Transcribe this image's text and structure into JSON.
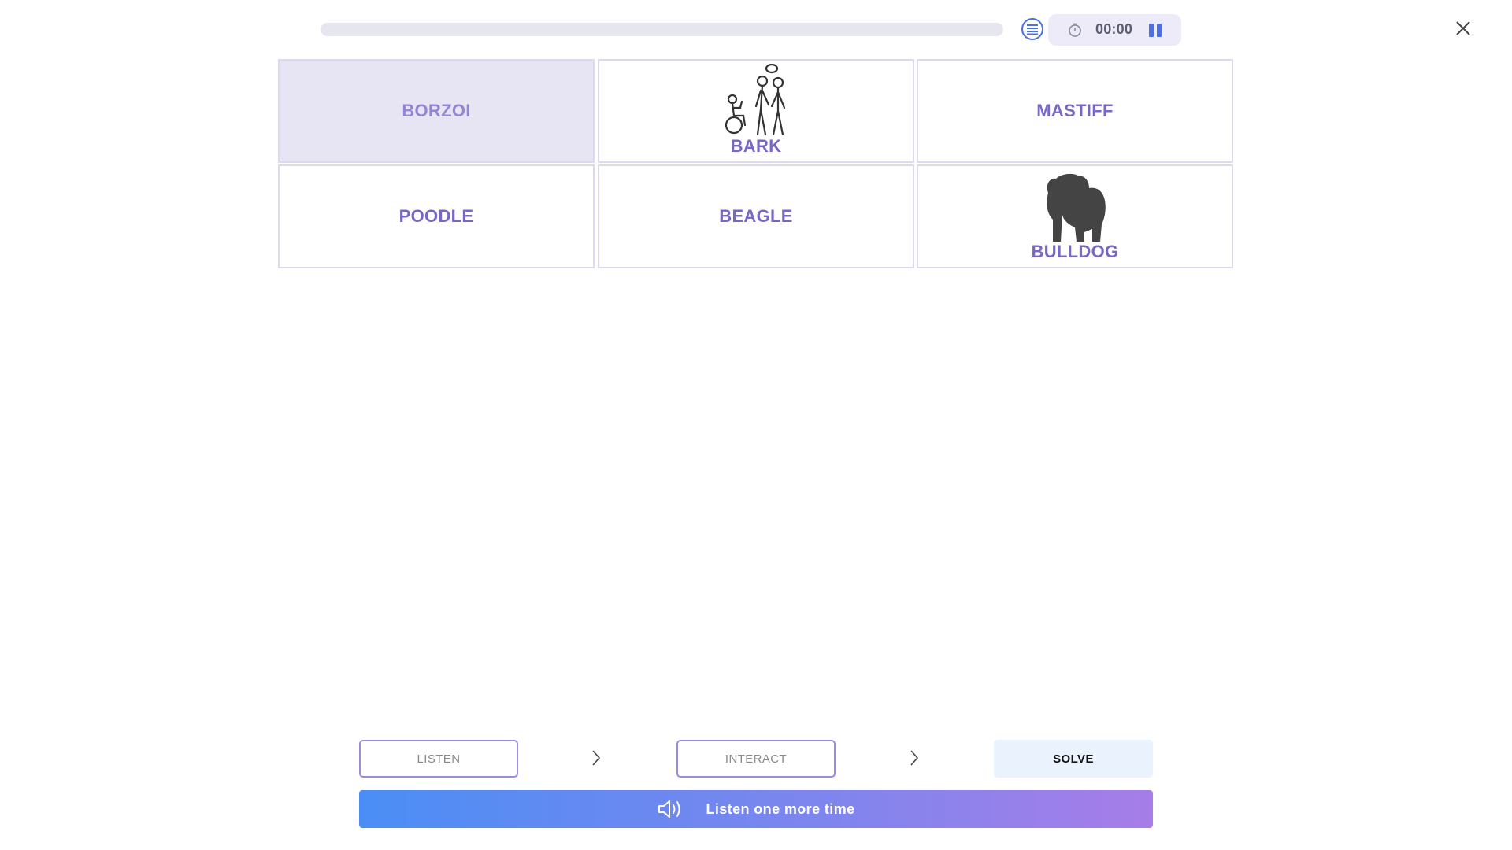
{
  "header": {
    "progress": 0,
    "timer": "00:00",
    "icons": {
      "list": "list-icon",
      "timer": "stopwatch-icon",
      "pause": "pause-icon",
      "close": "close-icon"
    }
  },
  "tiles": [
    {
      "label": "BORZOI",
      "selected": true,
      "image": null
    },
    {
      "label": "BARK",
      "selected": false,
      "image": "people-talking-illustration"
    },
    {
      "label": "MASTIFF",
      "selected": false,
      "image": null
    },
    {
      "label": "POODLE",
      "selected": false,
      "image": null
    },
    {
      "label": "BEAGLE",
      "selected": false,
      "image": null
    },
    {
      "label": "BULLDOG",
      "selected": false,
      "image": "bulldog-silhouette"
    }
  ],
  "steps": {
    "listen": "LISTEN",
    "interact": "INTERACT",
    "solve": "SOLVE"
  },
  "listen_button": {
    "label": "Listen one more time",
    "icon": "speaker-icon"
  },
  "colors": {
    "accent": "#7a66c4",
    "selected_bg": "#e7e5f4",
    "gradient_start": "#4a8ef5",
    "gradient_end": "#a77de8"
  }
}
